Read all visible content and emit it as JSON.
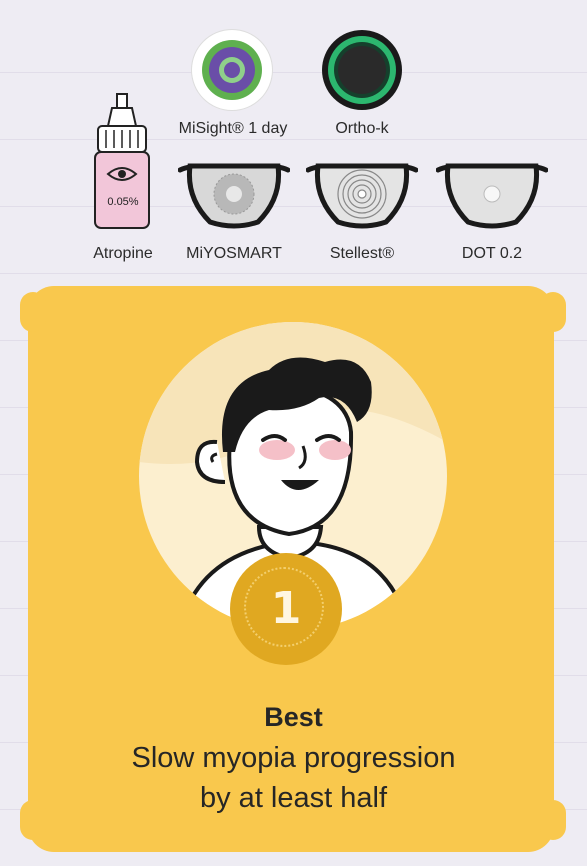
{
  "treatments": {
    "misight": {
      "label": "MiSight® 1 day",
      "icon": "contact-lens-icon"
    },
    "orthok": {
      "label": "Ortho-k",
      "icon": "ortho-k-lens-icon"
    },
    "atropine": {
      "label": "Atropine",
      "bottle_text": "0.05%",
      "icon": "eye-drop-bottle-icon"
    },
    "miyosmart": {
      "label": "MiYOSMART",
      "icon": "glasses-icon"
    },
    "stellest": {
      "label": "Stellest®",
      "icon": "glasses-icon"
    },
    "dot": {
      "label": "DOT 0.2",
      "icon": "glasses-icon"
    }
  },
  "card": {
    "rank": "1",
    "title": "Best",
    "line1": "Slow myopia progression",
    "line2": "by at least half",
    "colors": {
      "card": "#f9c84d",
      "medal": "#e0a821"
    }
  }
}
